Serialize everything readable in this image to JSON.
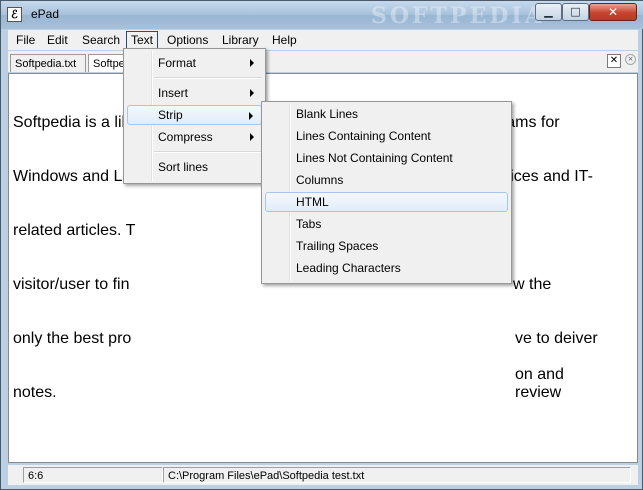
{
  "window": {
    "title": "ePad",
    "icon_glyph": "ℰ",
    "watermark": "SOFTPEDIA",
    "controls": {
      "minimize": "▁",
      "maximize": "□",
      "close": "✕"
    }
  },
  "menubar": {
    "items": [
      "File",
      "Edit",
      "Search",
      "Text",
      "Options",
      "Library",
      "Help"
    ]
  },
  "tabs": {
    "items": [
      "Softpedia.txt",
      "Softpe"
    ],
    "close_glyph": "✕",
    "close2_glyph": "×"
  },
  "editor": {
    "content": "Softpedia is a library of over 600,000 free and free-to-try software programs for Windows and Linux, games, Mac software, Windows drivers, mobile devices and IT-related articles. We review and categorize these products in order to allow the visitor/user to find the exact product they and their system needs. We strive to deiver only the best products to the visitor/user together with self-made evaluation and review notes.",
    "visible_lines": [
      "Softpedia is a lib",
      "Windows and Li",
      "related articles. T",
      "visitor/user to fin",
      "only the best pro",
      "notes."
    ],
    "visible_tail": [
      "free and free-to-try software programs for",
      "ware, Windows drivers, mobile devices and IT-",
      "",
      "w the",
      "ve to deiver",
      "on and review"
    ]
  },
  "text_menu": {
    "items": [
      {
        "label": "Format",
        "submenu": true
      },
      {
        "label": "Insert",
        "submenu": true
      },
      {
        "label": "Strip",
        "submenu": true,
        "highlighted": true
      },
      {
        "label": "Compress",
        "submenu": true
      },
      {
        "label": "Sort lines",
        "submenu": false
      }
    ]
  },
  "strip_menu": {
    "items": [
      {
        "label": "Blank Lines"
      },
      {
        "label": "Lines Containing Content"
      },
      {
        "label": "Lines Not Containing Content"
      },
      {
        "label": "Columns"
      },
      {
        "label": "HTML",
        "highlighted": true
      },
      {
        "label": "Tabs"
      },
      {
        "label": "Trailing Spaces"
      },
      {
        "label": "Leading Characters"
      }
    ]
  },
  "statusbar": {
    "position": "6:6",
    "path": "C:\\Program Files\\ePad\\Softpedia test.txt"
  }
}
